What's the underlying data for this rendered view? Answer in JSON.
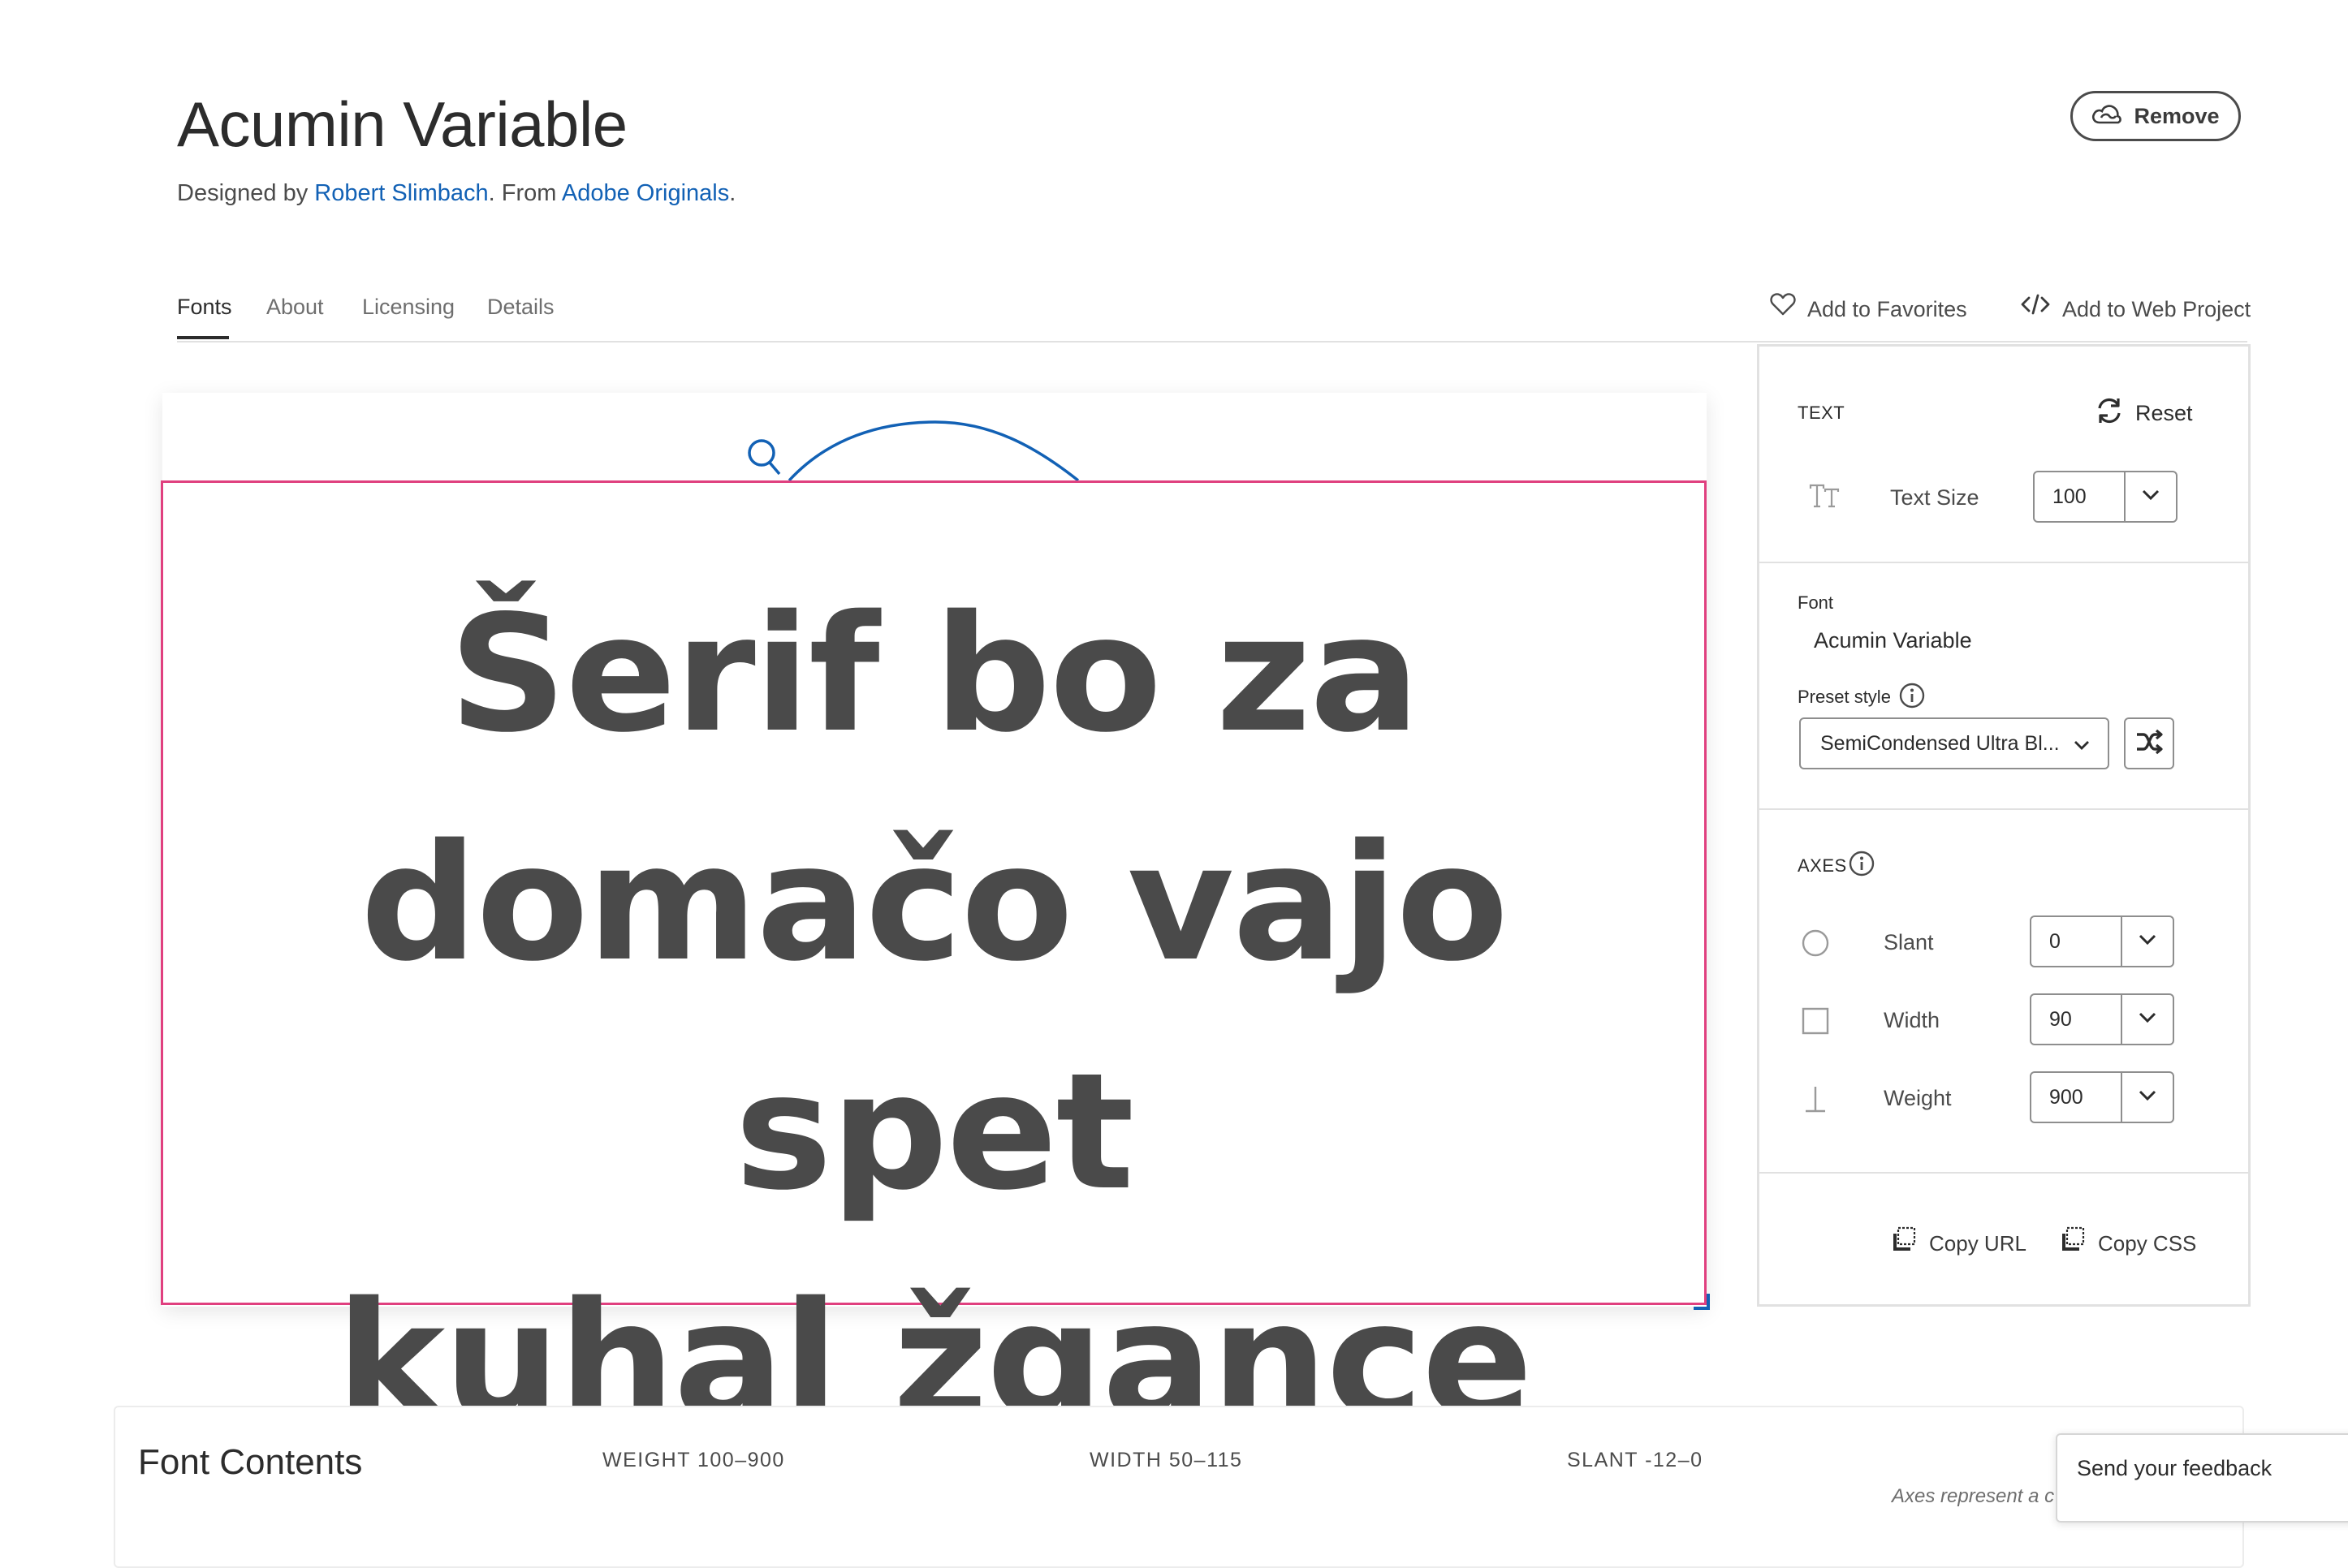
{
  "family": {
    "title": "Acumin Variable",
    "designed_by_prefix": "Designed by ",
    "designer": "Robert Slimbach",
    "from_prefix": ". From ",
    "foundry": "Adobe Originals",
    "suffix": "."
  },
  "header": {
    "remove_label": "Remove"
  },
  "tabs": [
    {
      "label": "Fonts",
      "active": true
    },
    {
      "label": "About"
    },
    {
      "label": "Licensing"
    },
    {
      "label": "Details"
    }
  ],
  "actions": {
    "favorites": "Add to Favorites",
    "web_project": "Add to Web Project"
  },
  "preview": {
    "lines": [
      "Šerif bo za",
      "domačo vajo spet",
      "kuhal žgance"
    ]
  },
  "panel": {
    "text_heading": "TEXT",
    "reset_label": "Reset",
    "text_size_label": "Text Size",
    "text_size_value": "100",
    "font_label": "Font",
    "font_name": "Acumin Variable",
    "preset_label": "Preset style",
    "preset_value": "SemiCondensed Ultra Bl...",
    "axes_heading": "AXES",
    "axes": [
      {
        "label": "Slant",
        "value": "0"
      },
      {
        "label": "Width",
        "value": "90"
      },
      {
        "label": "Weight",
        "value": "900"
      }
    ],
    "copy_url": "Copy URL",
    "copy_css": "Copy CSS"
  },
  "contents": {
    "title": "Font Contents",
    "weight": "WEIGHT 100–900",
    "width": "WIDTH 50–115",
    "slant": "SLANT -12–0",
    "note": "Axes represent a c"
  },
  "feedback": {
    "label": "Send your feedback"
  },
  "colors": {
    "link": "#1261b5",
    "frame": "#e0407f",
    "text": "#4a4a4a"
  }
}
